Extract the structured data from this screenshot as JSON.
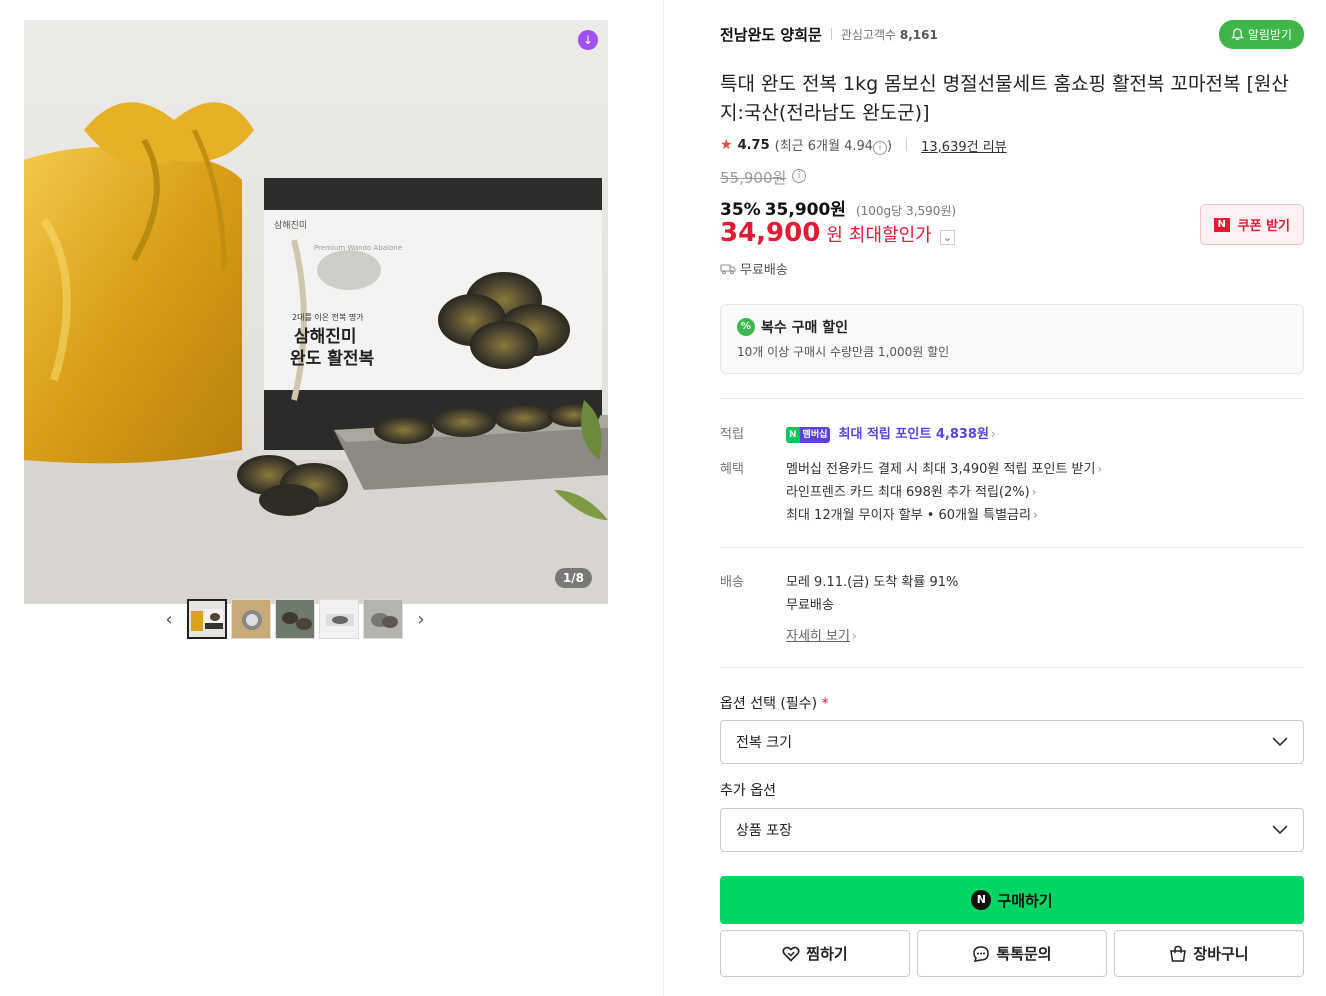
{
  "gallery": {
    "counter": "1/8",
    "download_icon": "↓",
    "prev_icon": "‹",
    "next_icon": "›",
    "box_brand": "삼해진미",
    "box_subtitle": "2대를 이은 전복 명가",
    "box_title_line1": "삼해진미",
    "box_title_line2": "완도 활전복",
    "box_english": "Premium Wando Abalone"
  },
  "store": {
    "name": "전남완도 양희문",
    "fans_label": "관심고객수",
    "fans_count": "8,161",
    "alarm_label": "알림받기"
  },
  "product": {
    "title": "특대 완도 전복 1kg 몸보신 명절선물세트 홈쇼핑 활전복 꼬마전복 [원산지:국산(전라남도 완도군)]",
    "rating": "4.75",
    "recent_rating": "(최근 6개월 4.94",
    "recent_rating_close": ")",
    "reviews": "13,639건 리뷰",
    "original_price": "55,900원",
    "discount_pct": "35%",
    "sale_price": "35,900원",
    "unit_price": "(100g당 3,590원)",
    "max_price": "34,900",
    "max_won": "원",
    "max_label": "최대할인가",
    "coupon_label": "쿠폰 받기",
    "shipping": "무료배송"
  },
  "multi_discount": {
    "title": "복수 구매 할인",
    "desc": "10개 이상 구매시 수량만큼 1,000원 할인",
    "icon": "%"
  },
  "points": {
    "label": "적립",
    "badge_n": "N",
    "badge_m": "멤버십",
    "text": "최대 적립 포인트 4,838원"
  },
  "benefits": {
    "label": "혜택",
    "items": [
      "멤버십 전용카드 결제 시 최대 3,490원 적립 포인트 받기",
      "라인프렌즈 카드 최대 698원 추가 적립(2%)",
      "최대 12개월 무이자 할부 • 60개월 특별금리"
    ]
  },
  "delivery": {
    "label": "배송",
    "eta": "모레 9.11.(금) 도착 확률 91%",
    "fee": "무료배송",
    "detail_link": "자세히 보기"
  },
  "options": {
    "required_label": "옵션 선택 (필수)",
    "required_mark": "*",
    "required_value": "전복 크기",
    "extra_label": "추가 옵션",
    "extra_value": "상품 포장"
  },
  "actions": {
    "buy": "구매하기",
    "buy_icon": "N",
    "wish": "찜하기",
    "talk": "톡톡문의",
    "cart": "장바구니"
  }
}
